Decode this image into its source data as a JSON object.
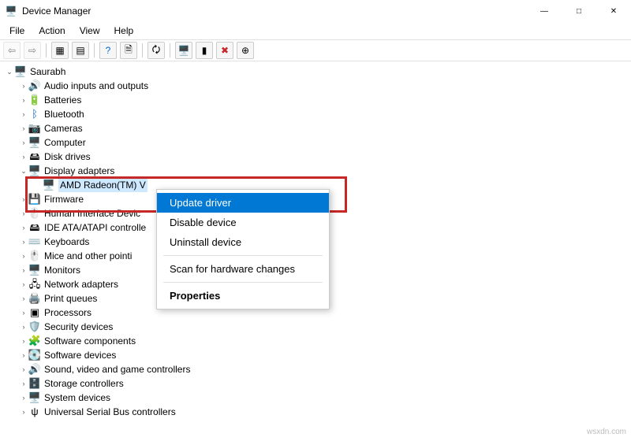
{
  "window": {
    "title": "Device Manager"
  },
  "menubar": {
    "file": "File",
    "action": "Action",
    "view": "View",
    "help": "Help"
  },
  "tree": {
    "root": "Saurabh",
    "items": [
      {
        "label": "Audio inputs and outputs",
        "icon": "🔊",
        "expandable": true
      },
      {
        "label": "Batteries",
        "icon": "🔋",
        "expandable": true
      },
      {
        "label": "Bluetooth",
        "icon": "ᛒ",
        "iconColor": "#0a63c4",
        "expandable": true
      },
      {
        "label": "Cameras",
        "icon": "📷",
        "expandable": true
      },
      {
        "label": "Computer",
        "icon": "🖥️",
        "expandable": true
      },
      {
        "label": "Disk drives",
        "icon": "🖴",
        "expandable": true
      },
      {
        "label": "Display adapters",
        "icon": "🖥️",
        "expanded": true,
        "children": [
          {
            "label": "AMD Radeon(TM) V",
            "icon": "🖥️",
            "selected": true
          }
        ]
      },
      {
        "label": "Firmware",
        "icon": "💾",
        "expandable": true
      },
      {
        "label": "Human Interface Devic",
        "icon": "🖱️",
        "expandable": true
      },
      {
        "label": "IDE ATA/ATAPI controlle",
        "icon": "🖴",
        "expandable": true
      },
      {
        "label": "Keyboards",
        "icon": "⌨️",
        "expandable": true
      },
      {
        "label": "Mice and other pointi",
        "icon": "🖱️",
        "expandable": true
      },
      {
        "label": "Monitors",
        "icon": "🖥️",
        "expandable": true
      },
      {
        "label": "Network adapters",
        "icon": "🖧",
        "expandable": true
      },
      {
        "label": "Print queues",
        "icon": "🖨️",
        "expandable": true
      },
      {
        "label": "Processors",
        "icon": "▣",
        "expandable": true
      },
      {
        "label": "Security devices",
        "icon": "🛡️",
        "expandable": true
      },
      {
        "label": "Software components",
        "icon": "🧩",
        "expandable": true
      },
      {
        "label": "Software devices",
        "icon": "💽",
        "expandable": true
      },
      {
        "label": "Sound, video and game controllers",
        "icon": "🔊",
        "expandable": true
      },
      {
        "label": "Storage controllers",
        "icon": "🗄️",
        "expandable": true
      },
      {
        "label": "System devices",
        "icon": "🖥️",
        "expandable": true
      },
      {
        "label": "Universal Serial Bus controllers",
        "icon": "ψ",
        "expandable": true
      }
    ]
  },
  "context_menu": {
    "update": "Update driver",
    "disable": "Disable device",
    "uninstall": "Uninstall device",
    "scan": "Scan for hardware changes",
    "properties": "Properties"
  },
  "watermark": "wsxdn.com"
}
